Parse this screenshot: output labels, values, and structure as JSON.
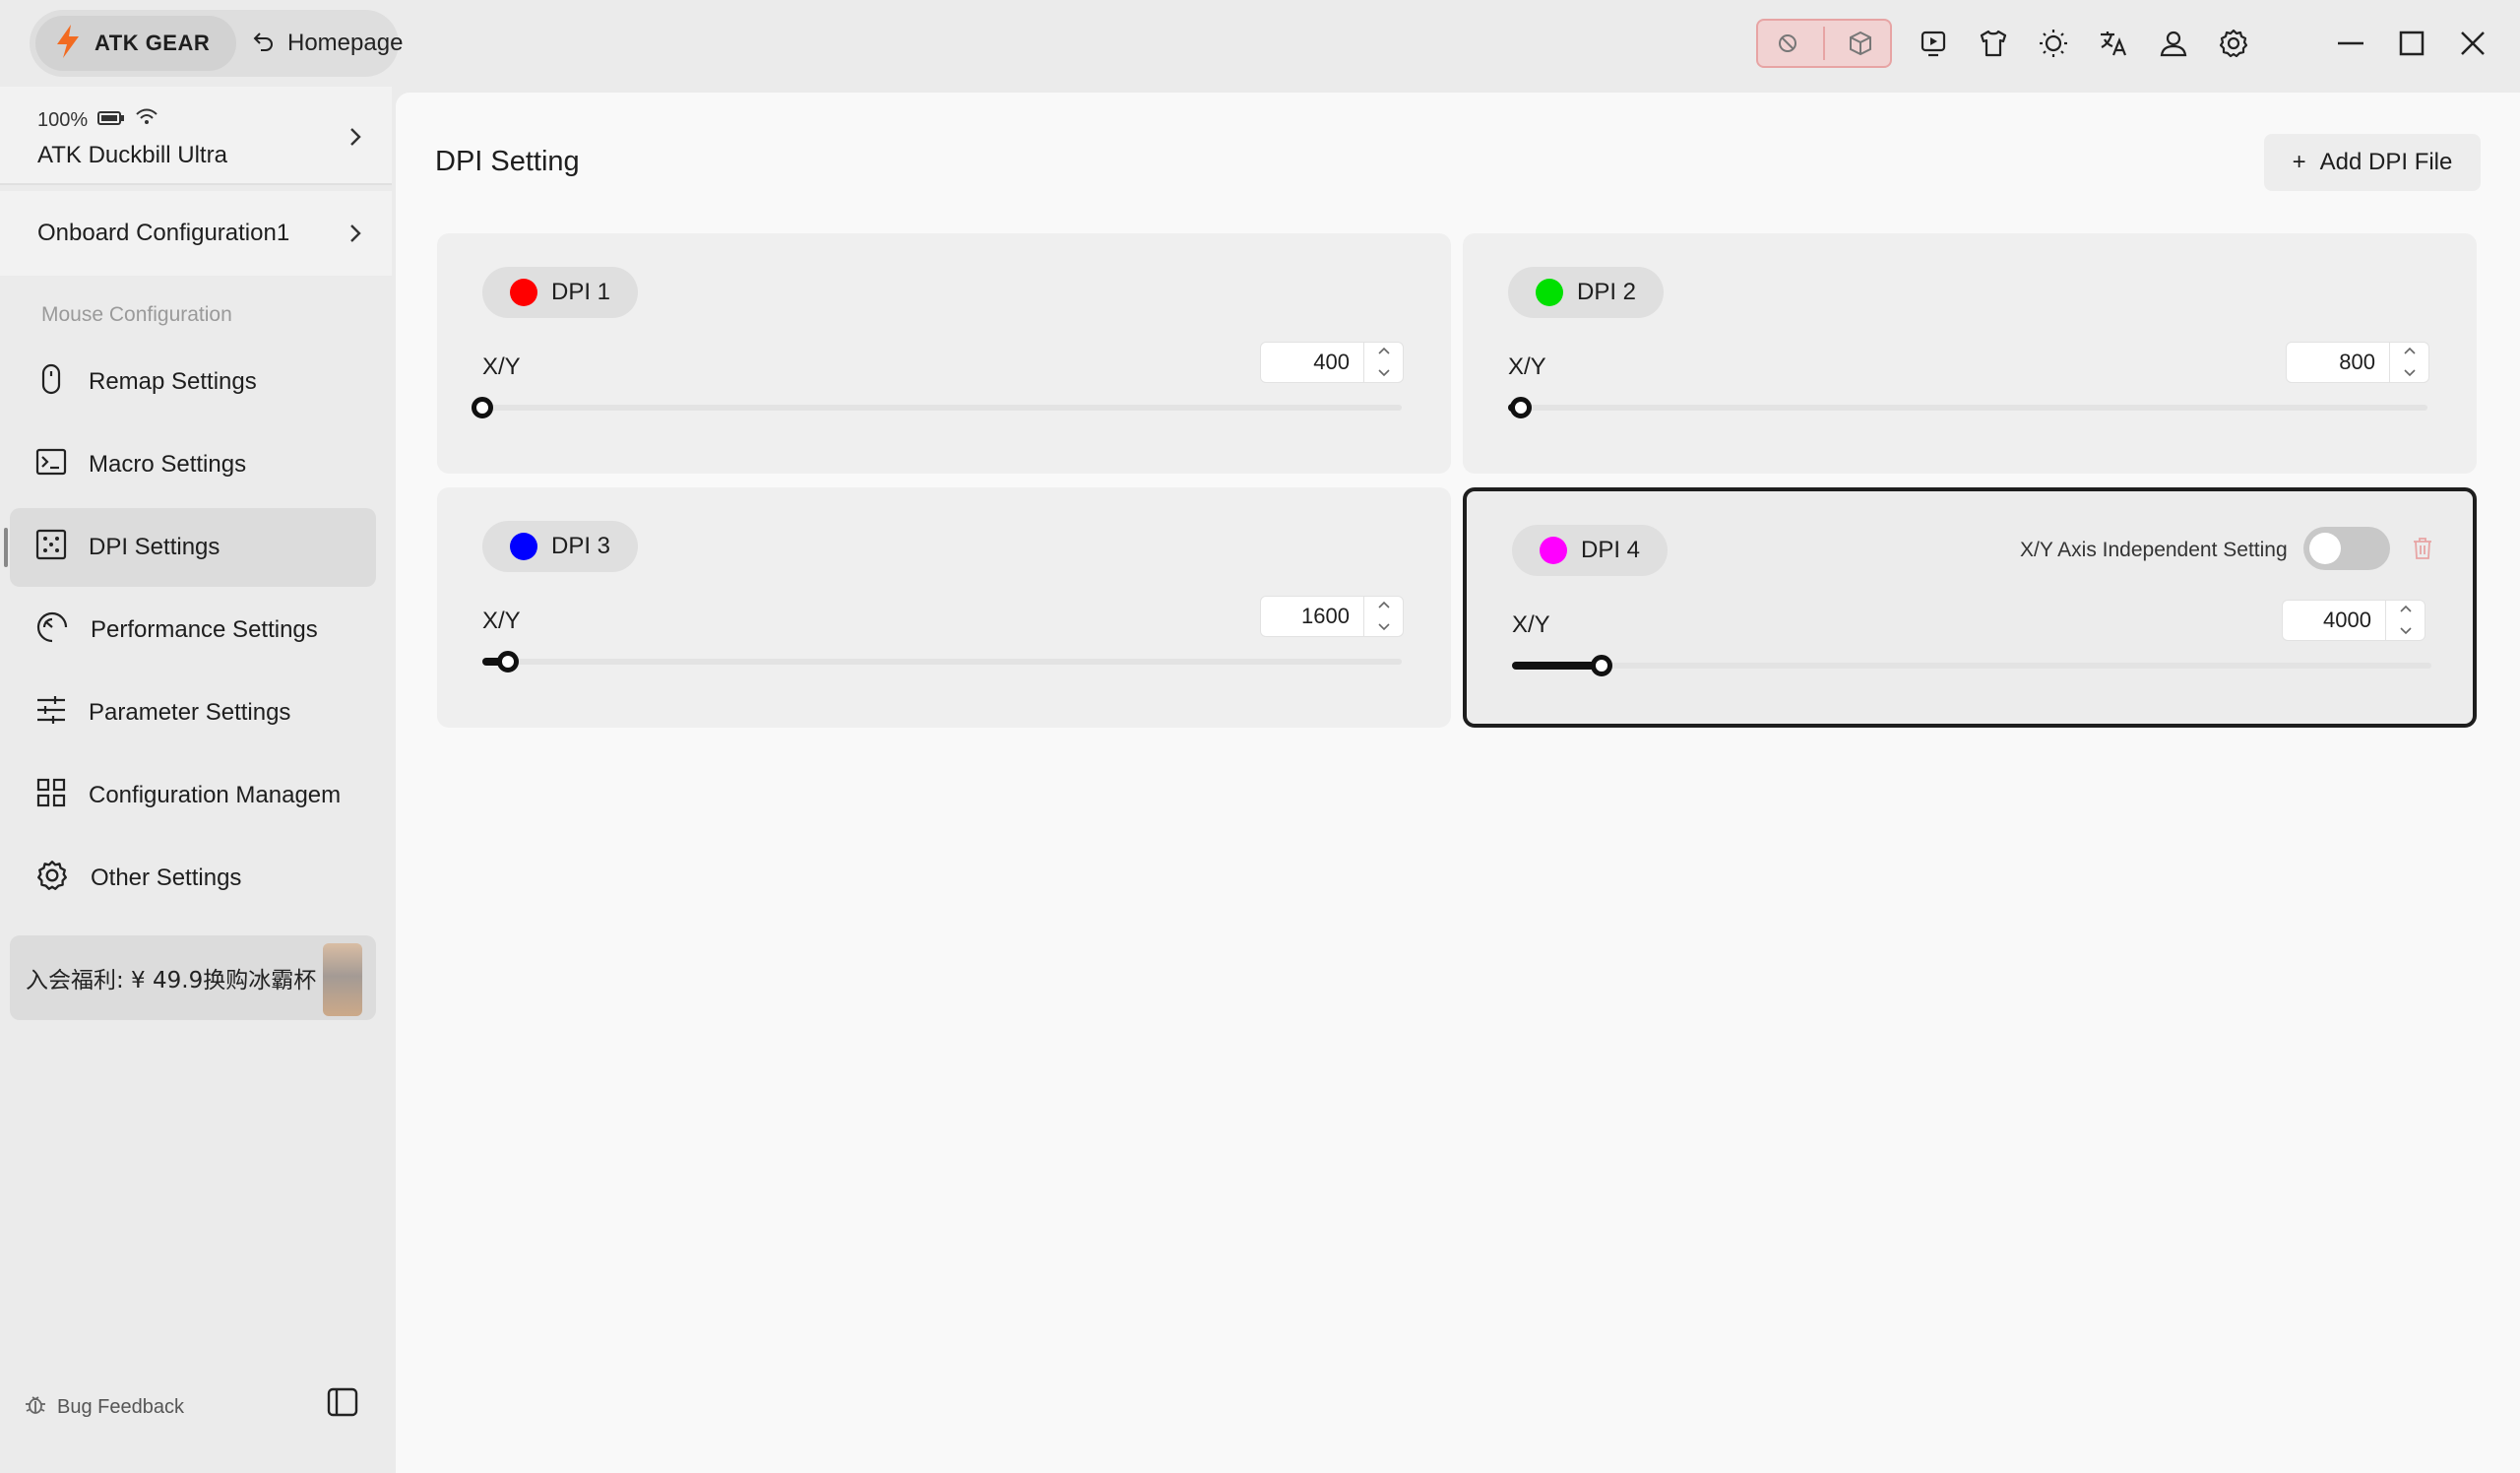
{
  "app": {
    "brand": "ATK GEAR",
    "home_label": "Homepage"
  },
  "colors": {
    "accent": "#1e1e1e",
    "brand_bolt": "#f26b21",
    "danger": "#e7a4a4"
  },
  "toolbar": {
    "icons": [
      "block-icon",
      "cube-icon",
      "play-icon",
      "shirt-icon",
      "brightness-icon",
      "translate-icon",
      "user-icon",
      "gear-icon"
    ],
    "window_controls": [
      "minimize-icon",
      "maximize-icon",
      "close-icon"
    ]
  },
  "sidebar": {
    "device": {
      "battery": "100%",
      "name": "ATK Duckbill Ultra"
    },
    "config_name": "Onboard Configuration1",
    "section_label": "Mouse Configuration",
    "items": [
      {
        "label": "Remap Settings",
        "icon": "mouse-icon"
      },
      {
        "label": "Macro Settings",
        "icon": "terminal-icon"
      },
      {
        "label": "DPI Settings",
        "icon": "dpi-icon",
        "active": true
      },
      {
        "label": "Performance Settings",
        "icon": "gauge-icon"
      },
      {
        "label": "Parameter Settings",
        "icon": "sliders-icon"
      },
      {
        "label": "Configuration Managem",
        "icon": "grid-icon"
      },
      {
        "label": "Other Settings",
        "icon": "gear-icon"
      }
    ],
    "promo": "入会福利: ¥ 49.9换购冰霸杯",
    "footer": {
      "bug_feedback": "Bug Feedback"
    }
  },
  "main": {
    "title": "DPI Setting",
    "add_button": "Add DPI File",
    "add_symbol": "+",
    "dpi_profiles": [
      {
        "label": "DPI 1",
        "color": "#ff0000",
        "axis_label": "X/Y",
        "value": "400",
        "slider_fraction": 0.0
      },
      {
        "label": "DPI 2",
        "color": "#00e000",
        "axis_label": "X/Y",
        "value": "800",
        "slider_fraction": 0.014
      },
      {
        "label": "DPI 3",
        "color": "#0000ff",
        "axis_label": "X/Y",
        "value": "1600",
        "slider_fraction": 0.028
      },
      {
        "label": "DPI 4",
        "color": "#ff00ff",
        "axis_label": "X/Y",
        "value": "4000",
        "slider_fraction": 0.097,
        "selected": true,
        "independent_label": "X/Y Axis Independent Setting",
        "independent_enabled": false
      }
    ]
  }
}
